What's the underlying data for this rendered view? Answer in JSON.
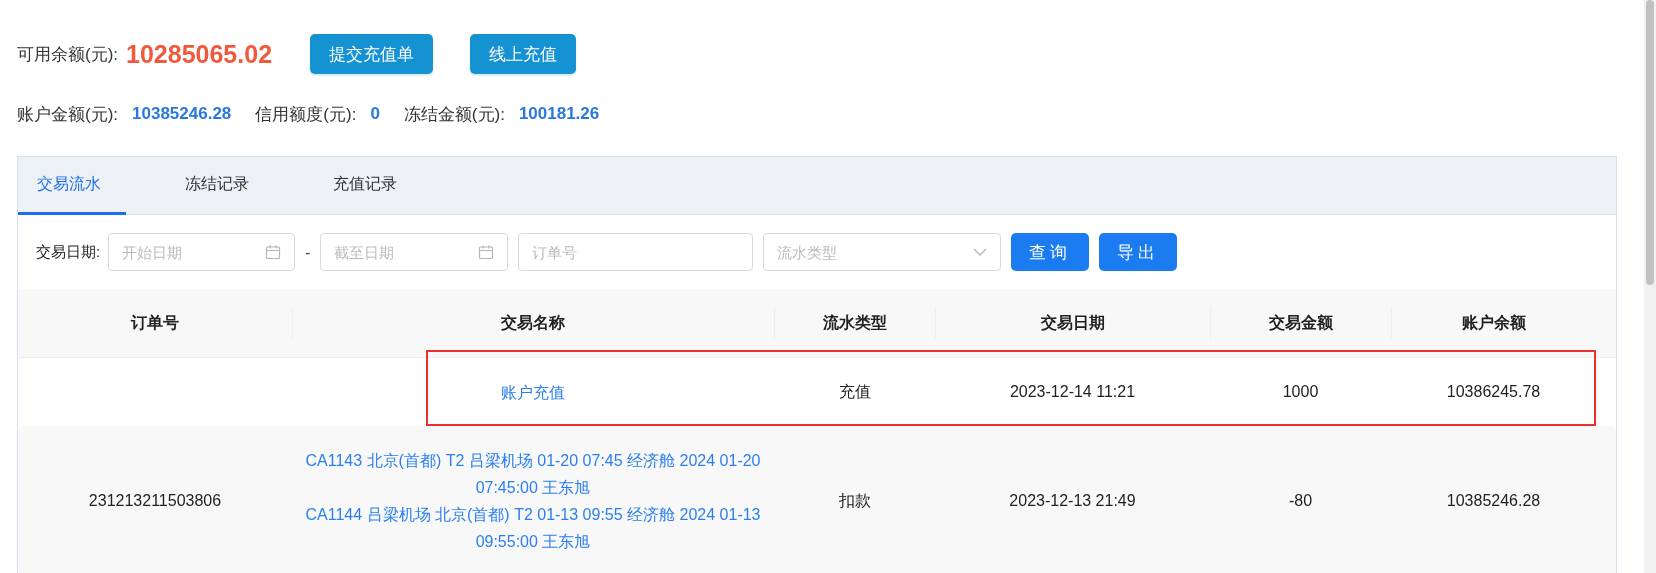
{
  "summary": {
    "available_label": "可用余额(元):",
    "available_value": "10285065.02",
    "buttons": [
      "提交充值单",
      "线上充值"
    ],
    "stats": [
      {
        "label": "账户金额(元):",
        "value": "10385246.28"
      },
      {
        "label": "信用额度(元):",
        "value": "0"
      },
      {
        "label": "冻结金额(元):",
        "value": "100181.26"
      }
    ]
  },
  "tabs": [
    {
      "label": "交易流水",
      "selected": true
    },
    {
      "label": "冻结记录",
      "selected": false
    },
    {
      "label": "充值记录",
      "selected": false
    }
  ],
  "filters": {
    "date_label": "交易日期:",
    "start_date": {
      "placeholder": "开始日期"
    },
    "separator": "-",
    "end_date": {
      "placeholder": "截至日期"
    },
    "order_no": {
      "placeholder": "订单号"
    },
    "flow_type": {
      "placeholder": "流水类型"
    },
    "buttons": [
      "查询",
      "导出"
    ]
  },
  "table": {
    "columns": [
      "订单号",
      "交易名称",
      "流水类型",
      "交易日期",
      "交易金额",
      "账户余额"
    ],
    "rows": [
      {
        "order_no": "",
        "names": [
          "账户充值"
        ],
        "type": "充值",
        "date": "2023-12-14 11:21",
        "amount": "1000",
        "balance": "10386245.78",
        "highlighted": true
      },
      {
        "order_no": "231213211503806",
        "names": [
          "CA1143 北京(首都) T2 吕梁机场 01-20 07:45 经济舱 2024 01-20 07:45:00 王东旭",
          "CA1144 吕梁机场 北京(首都) T2 01-13 09:55 经济舱 2024 01-13 09:55:00 王东旭"
        ],
        "type": "扣款",
        "date": "2023-12-13 21:49",
        "amount": "-80",
        "balance": "10385246.28",
        "highlighted": false
      }
    ]
  }
}
